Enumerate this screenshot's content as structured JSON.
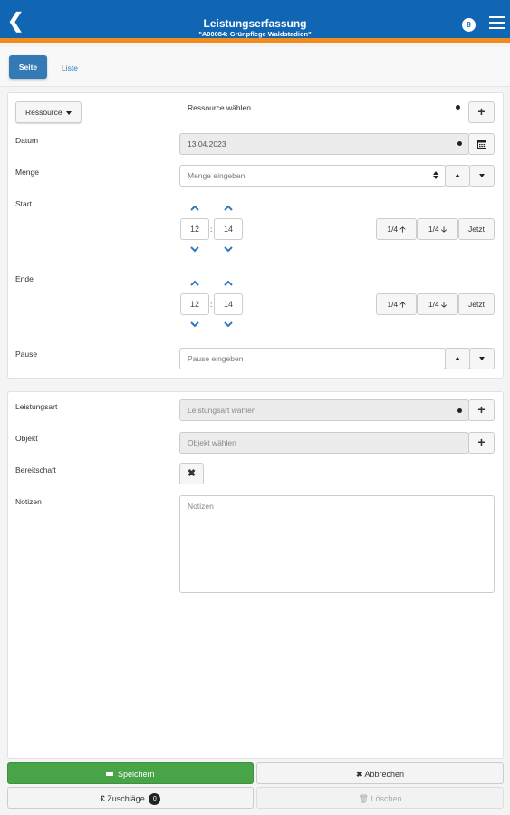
{
  "header": {
    "title": "Leistungserfassung",
    "subtitle": "\"A00084: Grünpflege Waldstadion\"",
    "badge": "8"
  },
  "tabs": {
    "page": "Seite",
    "list": "Liste"
  },
  "ressource": {
    "dropdown_label": "Ressource",
    "value": "Ressource wählen"
  },
  "datum": {
    "label": "Datum",
    "value": "13.04.2023"
  },
  "menge": {
    "label": "Menge",
    "placeholder": "Menge eingeben"
  },
  "start": {
    "label": "Start",
    "hour": "12",
    "minute": "14",
    "quarter_up": "1/4",
    "quarter_down": "1/4",
    "now": "Jetzt"
  },
  "ende": {
    "label": "Ende",
    "hour": "12",
    "minute": "14",
    "quarter_up": "1/4",
    "quarter_down": "1/4",
    "now": "Jetzt"
  },
  "pause": {
    "label": "Pause",
    "placeholder": "Pause eingeben"
  },
  "leistungsart": {
    "label": "Leistungsart",
    "placeholder": "Leistungsart wählen"
  },
  "objekt": {
    "label": "Objekt",
    "placeholder": "Objekt wählen"
  },
  "bereitschaft": {
    "label": "Bereitschaft"
  },
  "notizen": {
    "label": "Notizen",
    "placeholder": "Notizen"
  },
  "footer": {
    "save": "Speichern",
    "cancel": "Abbrechen",
    "surcharges": "Zuschläge",
    "surcharges_count": "0",
    "delete": "Löschen"
  },
  "colors": {
    "header": "#1166b3",
    "accent_line": "#f08c1e",
    "primary": "#337ab7",
    "success": "#47a447"
  }
}
